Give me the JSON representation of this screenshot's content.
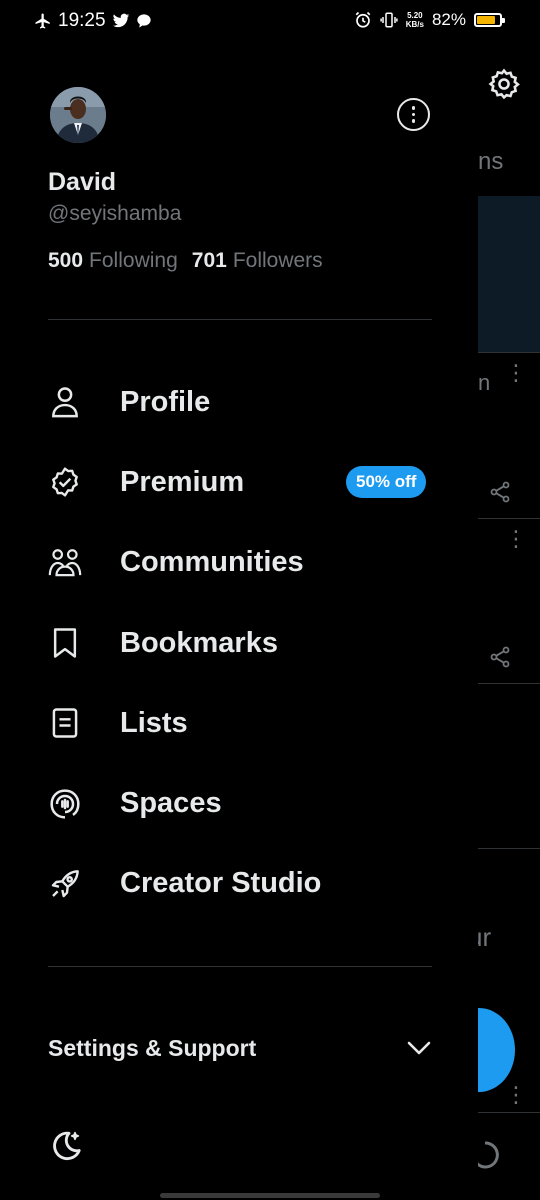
{
  "status_bar": {
    "time": "19:25",
    "net_speed_value": "5.20",
    "net_speed_unit": "KB/s",
    "battery_percent": "82%",
    "battery_level": 0.82,
    "left_icons": [
      "airplane-icon",
      "twitter-icon",
      "chat-icon"
    ],
    "right_icons": [
      "alarm-icon",
      "vibrate-icon",
      "battery-icon"
    ]
  },
  "profile": {
    "name": "David",
    "handle": "@seyishamba",
    "following_count": "500",
    "following_label": "Following",
    "followers_count": "701",
    "followers_label": "Followers"
  },
  "menu": {
    "items": [
      {
        "label": "Profile",
        "icon": "person-icon"
      },
      {
        "label": "Premium",
        "icon": "verified-badge-icon",
        "badge": "50% off"
      },
      {
        "label": "Communities",
        "icon": "communities-icon"
      },
      {
        "label": "Bookmarks",
        "icon": "bookmark-icon"
      },
      {
        "label": "Lists",
        "icon": "list-icon"
      },
      {
        "label": "Spaces",
        "icon": "spaces-icon"
      },
      {
        "label": "Creator Studio",
        "icon": "rocket-icon"
      }
    ]
  },
  "settings": {
    "label": "Settings & Support",
    "icon": "chevron-down-icon"
  },
  "background": {
    "tab_fragment": "ns",
    "post_fragment": "ur",
    "top_fragment": "n"
  },
  "colors": {
    "accent": "#1d9bf0",
    "text_primary": "#e7e9ea",
    "text_secondary": "#71767b",
    "divider": "#2f3336",
    "battery": "#f5b400"
  }
}
